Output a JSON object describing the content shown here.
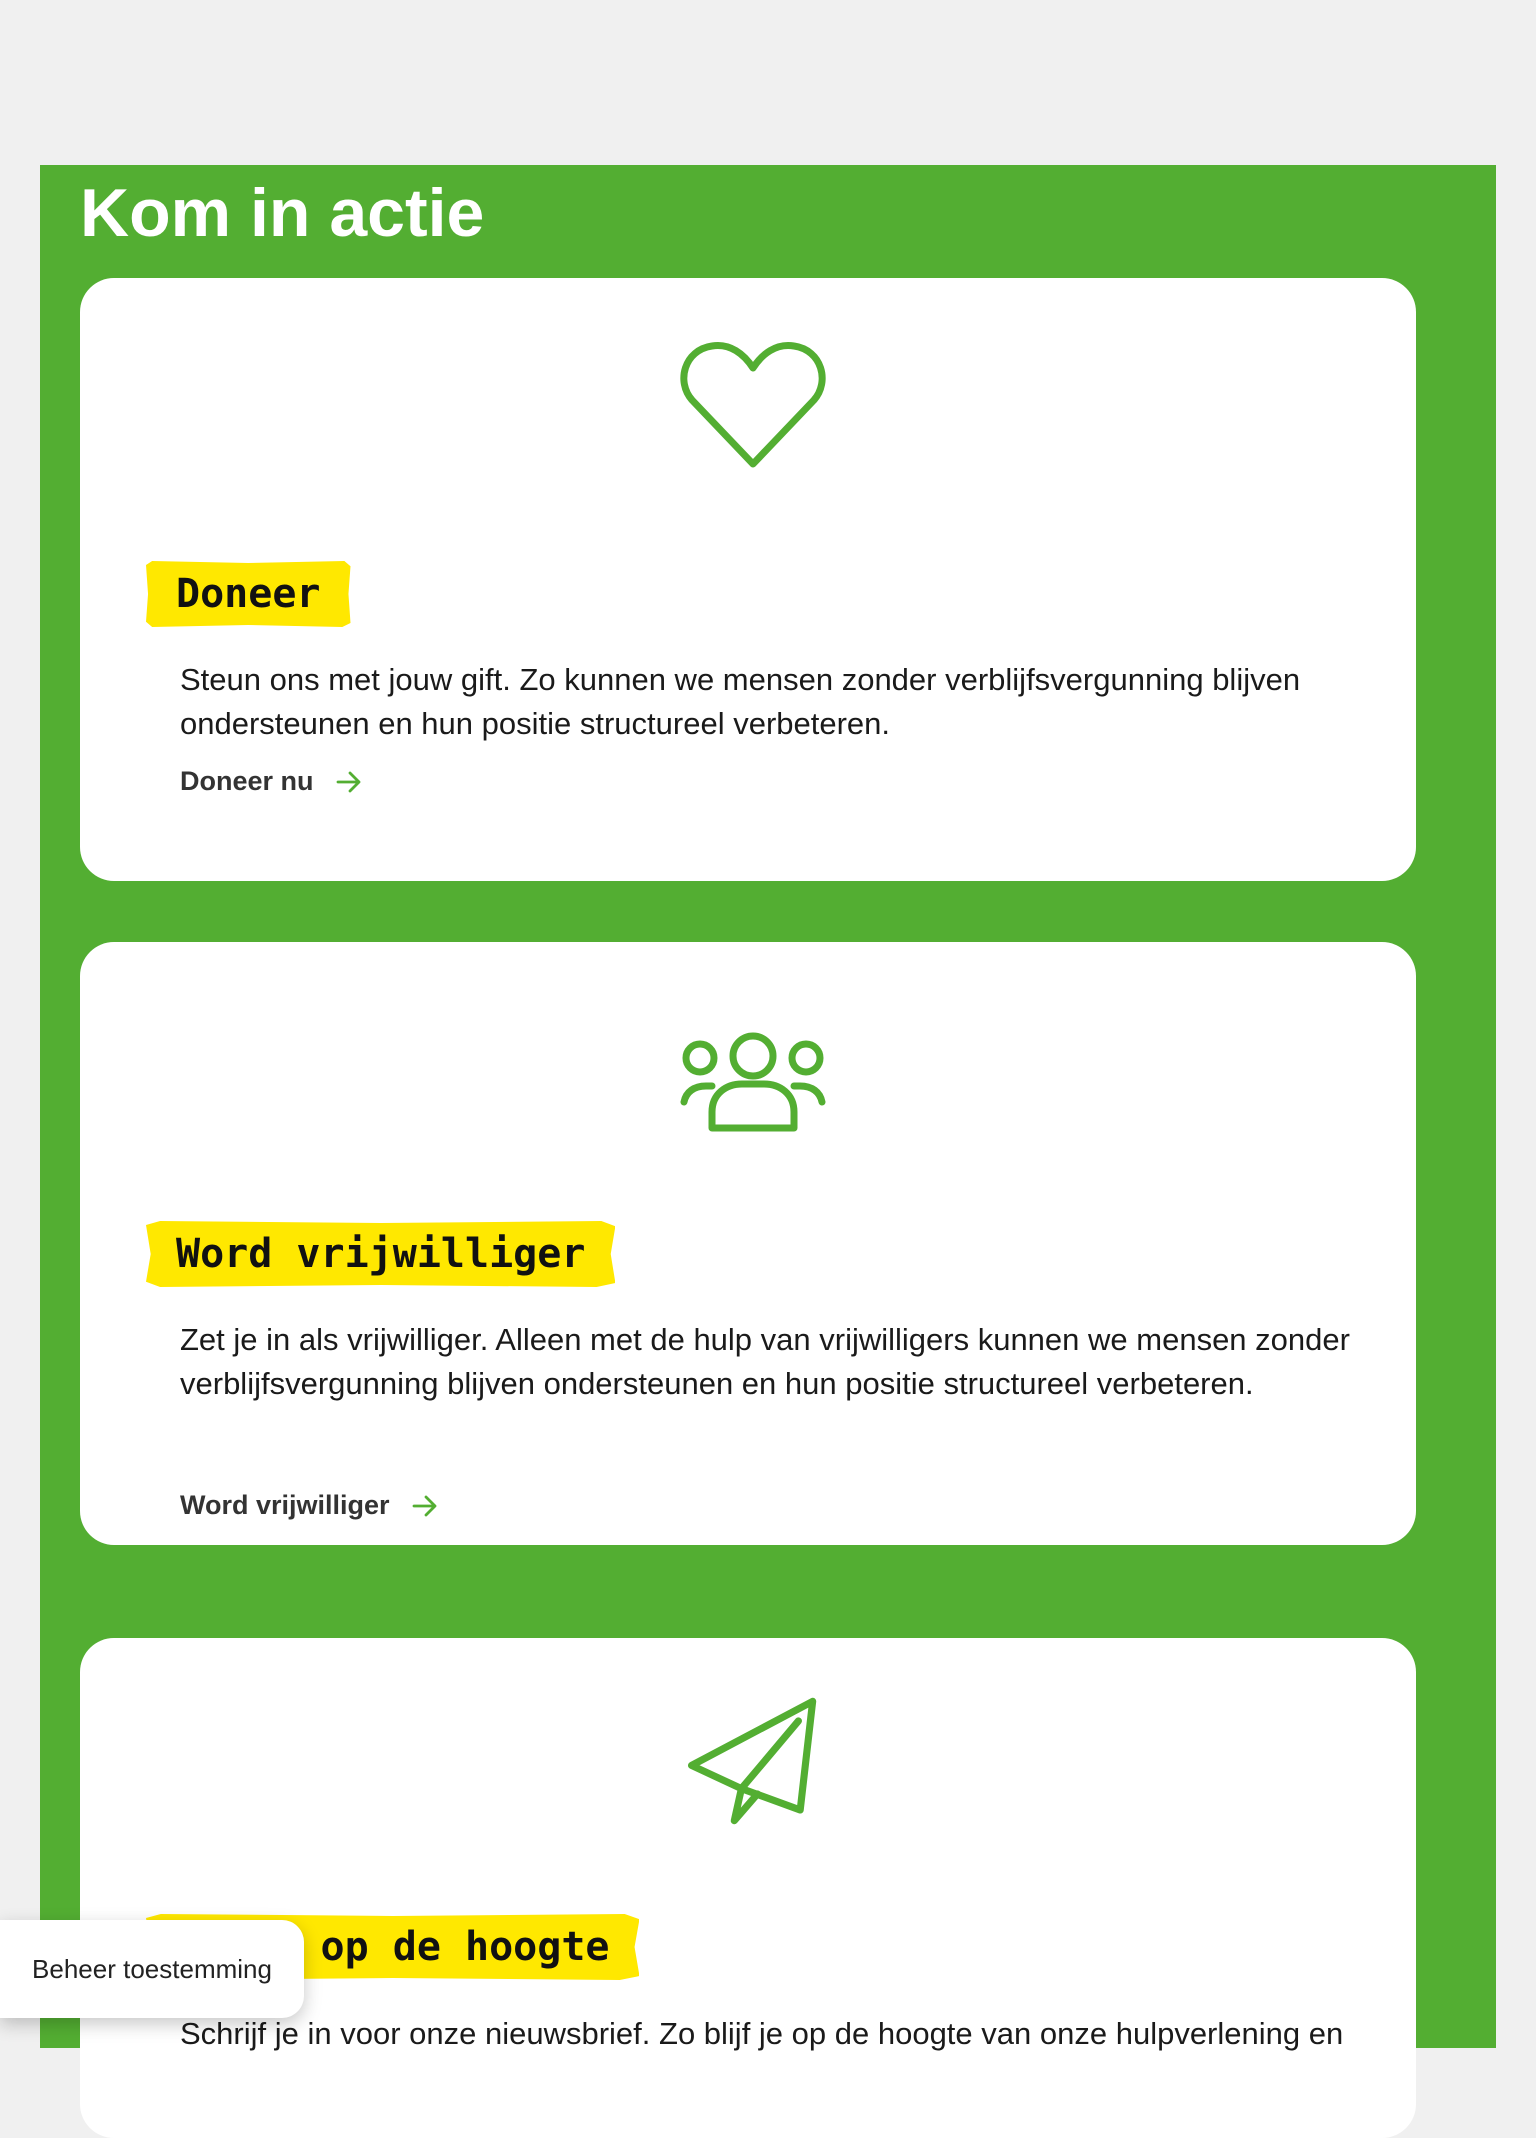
{
  "section": {
    "title": "Kom in actie"
  },
  "cards": [
    {
      "icon": "heart-icon",
      "heading": "Doneer",
      "text": "Steun ons met jouw gift. Zo kunnen we mensen zonder verblijfsvergunning blijven ondersteunen en hun positie structureel verbeteren.",
      "link_label": "Doneer nu"
    },
    {
      "icon": "people-icon",
      "heading": "Word vrijwilliger",
      "text": "Zet je in als vrijwilliger. Alleen met de hulp van vrijwilligers kunnen we mensen zonder verblijfsvergunning blijven ondersteunen en hun positie structureel verbeteren.",
      "link_label": "Word vrijwilliger"
    },
    {
      "icon": "paper-plane-icon",
      "heading": "Blijf op de hoogte",
      "text": "Schrijf je in voor onze nieuwsbrief. Zo blijf je op de hoogte van onze hulpverlening en"
    }
  ],
  "consent": {
    "label": "Beheer toestemming"
  },
  "colors": {
    "brand_green": "#53ae32",
    "highlight_yellow": "#ffe800",
    "page_background": "#f0f0f0"
  }
}
